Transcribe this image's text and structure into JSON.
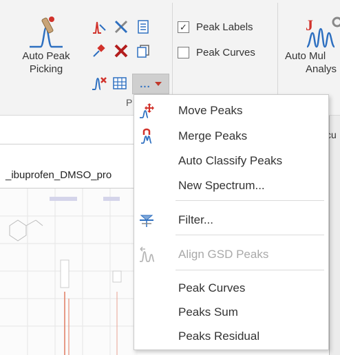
{
  "ribbon": {
    "auto_peak_picking": {
      "line1": "Auto Peak",
      "line2": "Picking",
      "icon": "peak-picking-icon"
    },
    "group_label_partial": "P",
    "more_button": {
      "label": "...",
      "icon": "more-dropdown-icon"
    },
    "small_tools": [
      {
        "name": "peak-edit-tool-icon"
      },
      {
        "name": "tools-icon"
      },
      {
        "name": "document-list-icon"
      },
      {
        "name": "pin-peak-icon"
      },
      {
        "name": "remove-peak-icon"
      },
      {
        "name": "copy-icon"
      },
      {
        "name": "delete-peak-icon"
      },
      {
        "name": "table-icon"
      }
    ],
    "peak_labels": {
      "label": "Peak Labels",
      "checked": true
    },
    "peak_curves": {
      "label": "Peak Curves",
      "checked": false
    },
    "auto_multi": {
      "line1": "Auto Mul",
      "line2": "Analys",
      "icon": "auto-multiplet-icon"
    }
  },
  "document": {
    "tab_title": "_ibuprofen_DMSO_pro",
    "right_partial": "cu"
  },
  "menu": {
    "items": [
      {
        "label": "Move Peaks",
        "icon": "move-peaks-icon",
        "enabled": true
      },
      {
        "label": "Merge Peaks",
        "icon": "merge-peaks-icon",
        "enabled": true
      },
      {
        "label": "Auto Classify Peaks",
        "icon": "",
        "enabled": true
      },
      {
        "label": "New Spectrum...",
        "icon": "",
        "enabled": true
      },
      {
        "label": "Filter...",
        "icon": "filter-icon",
        "enabled": true
      },
      {
        "label": "Align GSD Peaks",
        "icon": "align-gsd-peaks-icon",
        "enabled": false
      },
      {
        "label": "Peak Curves",
        "icon": "",
        "enabled": true
      },
      {
        "label": "Peaks Sum",
        "icon": "",
        "enabled": true
      },
      {
        "label": "Peaks Residual",
        "icon": "",
        "enabled": true
      }
    ]
  },
  "colors": {
    "accent_blue": "#2d6fc0",
    "accent_red": "#d1322b",
    "ribbon_bg": "#f3f3f3"
  }
}
